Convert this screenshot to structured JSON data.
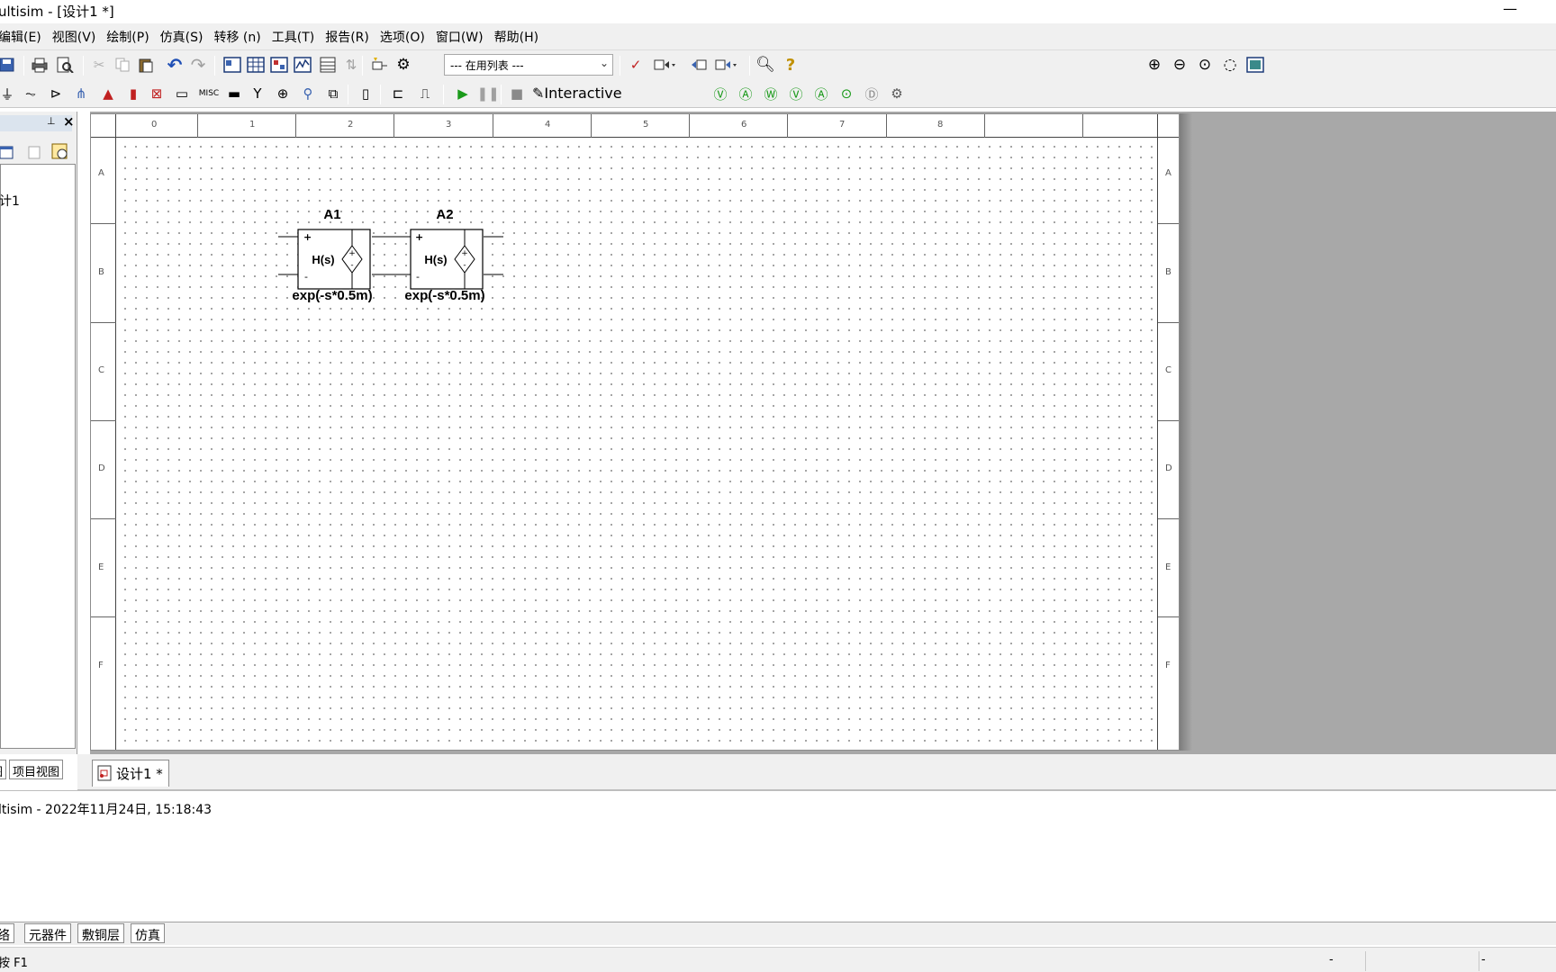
{
  "window": {
    "title": "ultisim - [设计1 *]",
    "minimize": "—"
  },
  "menu": [
    "编辑(E)",
    "视图(V)",
    "绘制(P)",
    "仿真(S)",
    "转移 (n)",
    "工具(T)",
    "报告(R)",
    "选项(O)",
    "窗口(W)",
    "帮助(H)"
  ],
  "toolbar": {
    "in_use_list": "--- 在用列表 ---",
    "interactive": "Interactive"
  },
  "design_toolbox": {
    "tree_item": "计1",
    "tabs": [
      "图",
      "项目视图"
    ]
  },
  "sheet": {
    "columns": [
      "0",
      "1",
      "2",
      "3",
      "4",
      "5",
      "6",
      "7",
      "8"
    ],
    "rows": [
      "A",
      "B",
      "C",
      "D",
      "E",
      "F"
    ]
  },
  "components": [
    {
      "ref": "A1",
      "block": "H(s)",
      "value": "exp(-s*0.5m)"
    },
    {
      "ref": "A2",
      "block": "H(s)",
      "value": "exp(-s*0.5m)"
    }
  ],
  "doc_tab": "设计1 *",
  "log": "ltisim  -  2022年11月24日, 15:18:43",
  "bottom_tabs": [
    "络",
    "元器件",
    "敷铜层",
    "仿真"
  ],
  "status": {
    "help": "按 F1",
    "cell1": "-",
    "cell2": "-"
  }
}
